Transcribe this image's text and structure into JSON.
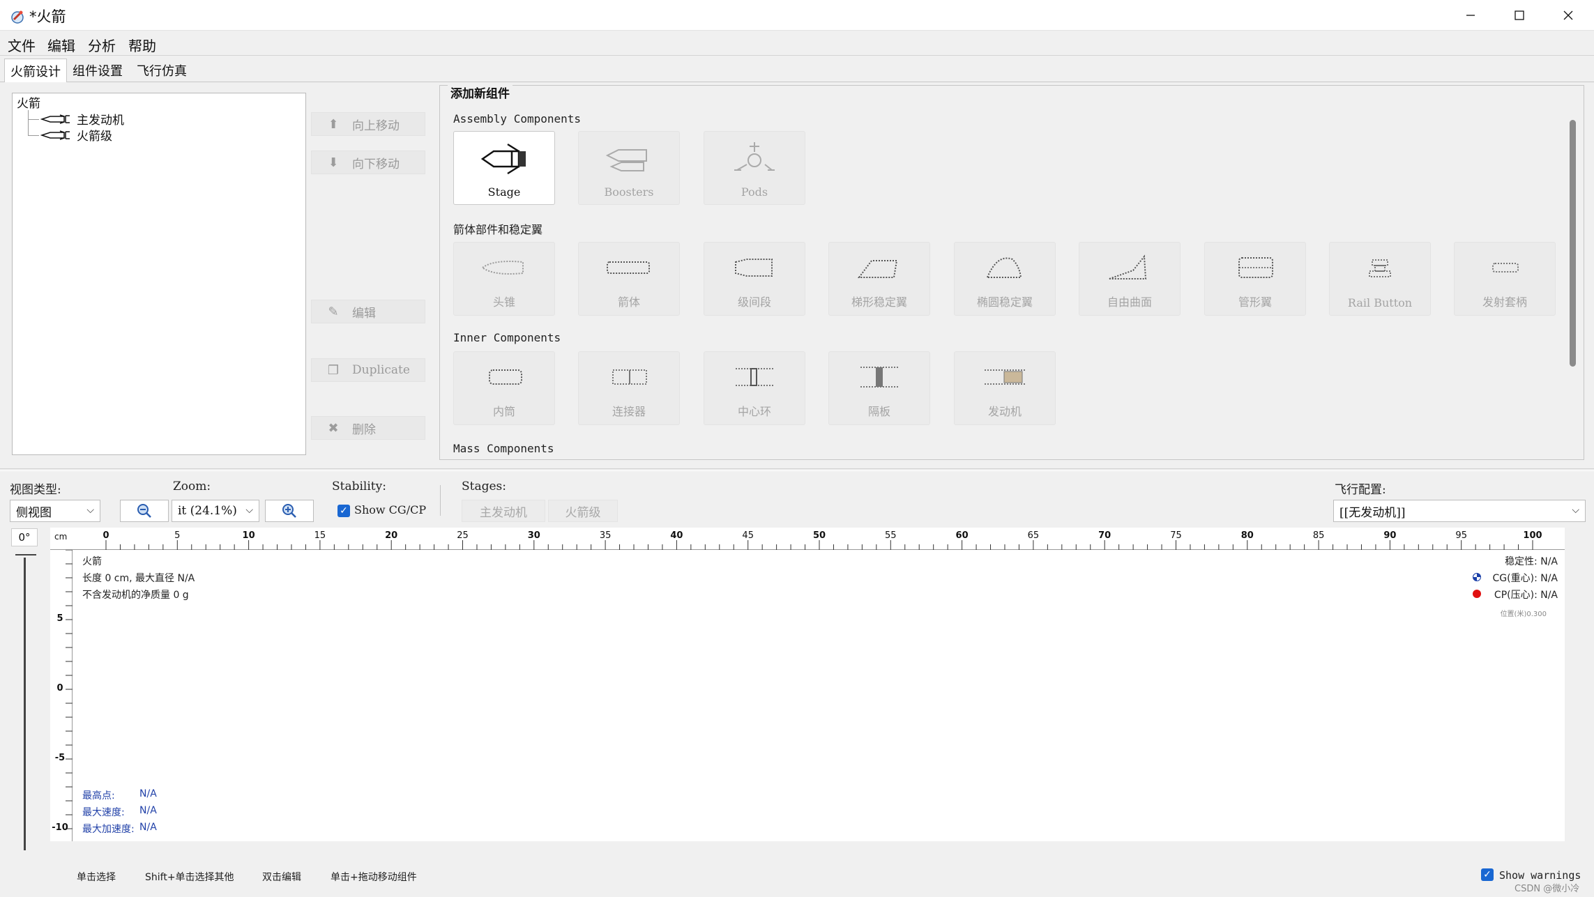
{
  "window": {
    "title": "*火箭"
  },
  "menu": [
    "文件",
    "编辑",
    "分析",
    "帮助"
  ],
  "tabs": [
    "火箭设计",
    "组件设置",
    "飞行仿真"
  ],
  "tree": {
    "root": "火箭",
    "children": [
      "主发动机",
      "火箭级"
    ]
  },
  "side_buttons": {
    "move_up": "向上移动",
    "move_down": "向下移动",
    "edit": "编辑",
    "duplicate": "Duplicate",
    "delete": "删除"
  },
  "palette": {
    "title": "添加新组件",
    "groups": [
      {
        "label": "Assembly Components",
        "items": [
          "Stage",
          "Boosters",
          "Pods"
        ]
      },
      {
        "label": "箭体部件和稳定翼",
        "items": [
          "头锥",
          "箭体",
          "级间段",
          "梯形稳定翼",
          "椭圆稳定翼",
          "自由曲面",
          "管形翼",
          "Rail Button",
          "发射套柄"
        ]
      },
      {
        "label": "Inner Components",
        "items": [
          "内筒",
          "连接器",
          "中心环",
          "隔板",
          "发动机"
        ]
      },
      {
        "label": "Mass Components",
        "items": []
      }
    ]
  },
  "controls": {
    "view_type_label": "视图类型:",
    "view_type_value": "侧视图",
    "zoom_label": "Zoom:",
    "zoom_value": "it (24.1%)",
    "stability_label": "Stability:",
    "show_cgcp": "Show CG/CP",
    "stages_label": "Stages:",
    "stages": [
      "主发动机",
      "火箭级"
    ],
    "flight_config_label": "飞行配置:",
    "flight_config_value": "[[无发动机]]"
  },
  "canvas": {
    "angle": "0°",
    "unit": "cm",
    "x_ticks": [
      "0",
      "5",
      "10",
      "15",
      "20",
      "25",
      "30",
      "35",
      "40",
      "45",
      "50",
      "55",
      "60",
      "65",
      "70",
      "75",
      "80",
      "85",
      "90",
      "95",
      "100"
    ],
    "y_ticks": [
      "5",
      "0",
      "-5",
      "-10"
    ],
    "rocket_name": "火箭",
    "length_info": "长度 0 cm, 最大直径 N/A",
    "mass_info": "不含发动机的净质量 0 g",
    "stability": "稳定性: N/A",
    "cg": "CG(重心): N/A",
    "cp": "CP(压心): N/A",
    "position": "位置(米)0.300",
    "apogee_label": "最高点:",
    "apogee_value": "N/A",
    "max_velocity_label": "最大速度:",
    "max_velocity_value": "N/A",
    "max_accel_label": "最大加速度:",
    "max_accel_value": "N/A"
  },
  "status_bar": {
    "hints": [
      "单击选择",
      "Shift+单击选择其他",
      "双击编辑",
      "单击+拖动移动组件"
    ],
    "show_warnings": "Show warnings",
    "watermark": "CSDN @微小冷"
  }
}
